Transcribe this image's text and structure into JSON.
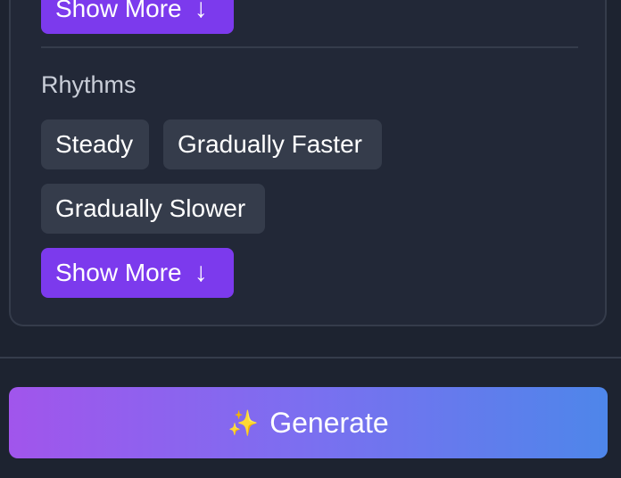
{
  "panel": {
    "top_show_more": {
      "label": "Show More",
      "icon": "arrow-down-icon",
      "arrow": "↓"
    },
    "rhythms": {
      "title": "Rhythms",
      "options": [
        {
          "label": "Steady"
        },
        {
          "label": "Gradually Faster"
        },
        {
          "label": "Gradually Slower"
        }
      ],
      "show_more": {
        "label": "Show More",
        "icon": "arrow-down-icon",
        "arrow": "↓"
      }
    }
  },
  "generate": {
    "label": "Generate",
    "icon": "sparkles-icon",
    "glyph": "✨"
  },
  "colors": {
    "accent": "#7c3aed",
    "chip_bg": "#353c4b",
    "gradient_start": "#a155ec",
    "gradient_end": "#4e86ea"
  }
}
